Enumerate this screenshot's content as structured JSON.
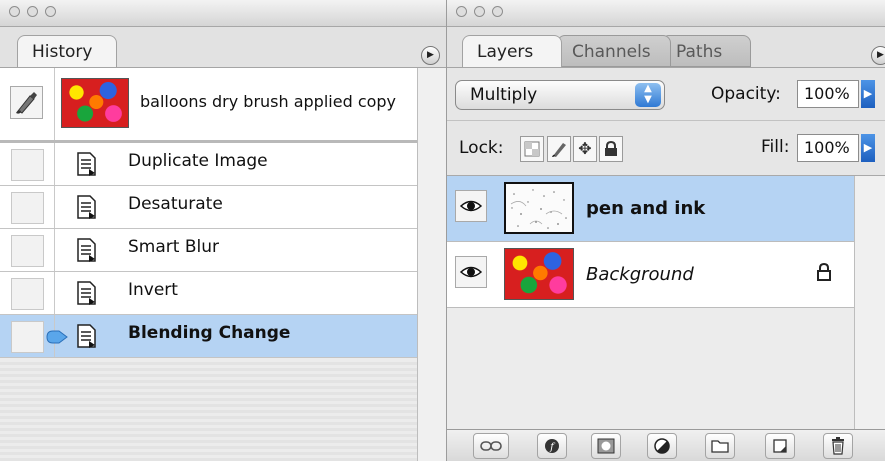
{
  "history_panel": {
    "tab_label": "History",
    "snapshot_label": "balloons dry brush applied copy",
    "states": [
      {
        "label": "Duplicate Image",
        "selected": false
      },
      {
        "label": "Desaturate",
        "selected": false
      },
      {
        "label": "Smart Blur",
        "selected": false
      },
      {
        "label": "Invert",
        "selected": false
      },
      {
        "label": "Blending Change",
        "selected": true
      }
    ]
  },
  "layers_panel": {
    "tabs": [
      "Layers",
      "Channels",
      "Paths"
    ],
    "blend_mode": "Multiply",
    "opacity_label": "Opacity:",
    "opacity_value": "100%",
    "lock_label": "Lock:",
    "fill_label": "Fill:",
    "fill_value": "100%",
    "layers": [
      {
        "name": "pen and ink",
        "selected": true,
        "italic": false,
        "locked": false
      },
      {
        "name": "Background",
        "selected": false,
        "italic": true,
        "locked": true
      }
    ],
    "bottom_icons": [
      "link-icon",
      "layer-style-icon",
      "layer-mask-icon",
      "adjustment-layer-icon",
      "new-group-icon",
      "new-layer-icon",
      "trash-icon"
    ]
  },
  "colors": {
    "selection": "#b5d3f3",
    "panel_bg": "#ececec",
    "accent_blue": "#2f79d4"
  }
}
